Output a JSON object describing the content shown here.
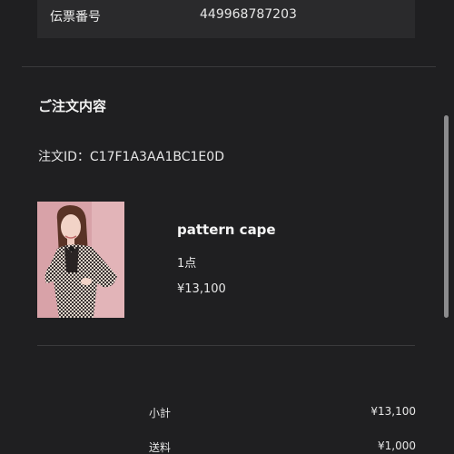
{
  "tracking": {
    "label": "伝票番号",
    "value": "449968787203"
  },
  "order": {
    "section_title": "ご注文内容",
    "order_id_text": "注文ID：C17F1A3AA1BC1E0D"
  },
  "product": {
    "name": "pattern cape",
    "quantity": "1点",
    "price": "¥13,100"
  },
  "summary": {
    "subtotal_label": "小計",
    "subtotal_value": "¥13,100",
    "shipping_label": "送料",
    "shipping_value": "¥1,000"
  },
  "colors": {
    "background": "#1f1f21",
    "card": "#2a2a2c",
    "text": "#eeeeee",
    "divider": "#3a3a3c"
  }
}
